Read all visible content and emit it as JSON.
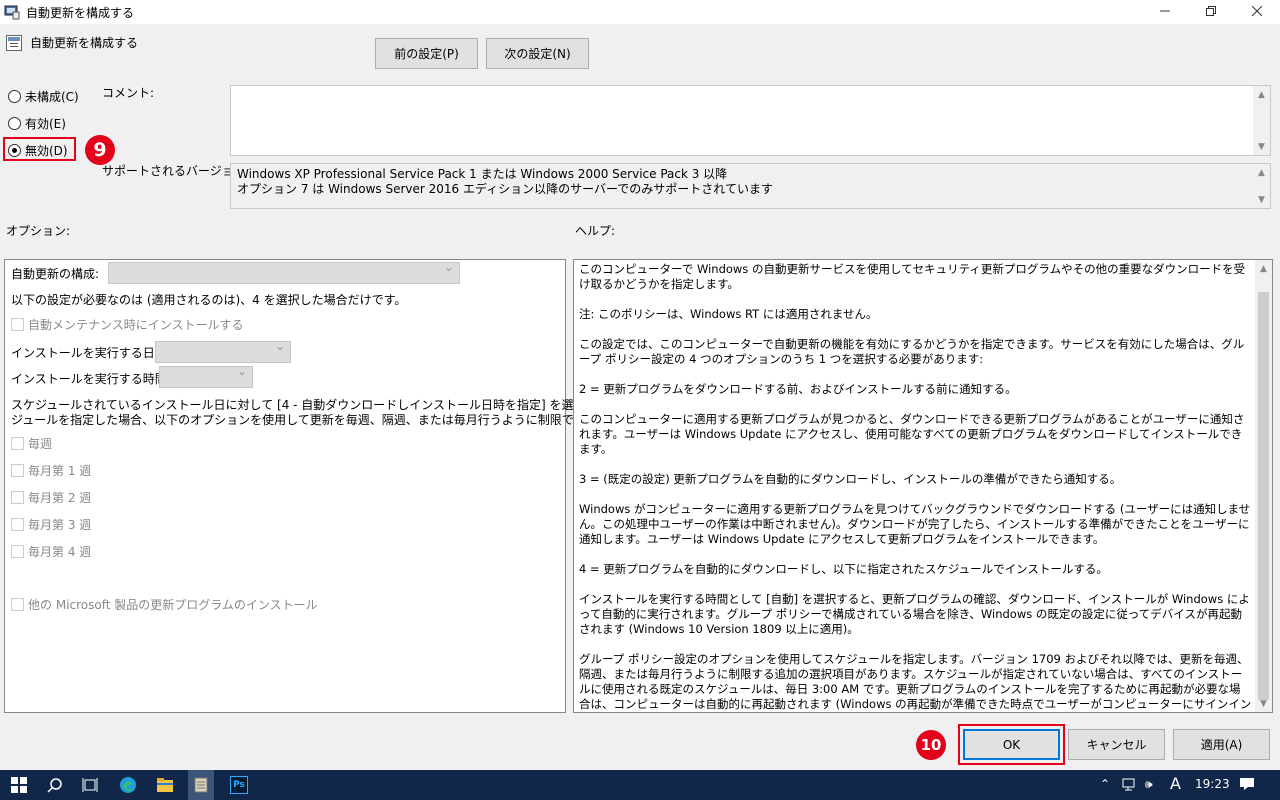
{
  "window": {
    "title": "自動更新を構成する",
    "minimize_icon": "minimize-icon",
    "maximize_icon": "restore-icon",
    "close_icon": "close-icon"
  },
  "header": {
    "policy_name": "自動更新を構成する",
    "prev_button": "前の設定(P)",
    "next_button": "次の設定(N)"
  },
  "state_options": {
    "not_configured": "未構成(C)",
    "enabled": "有効(E)",
    "disabled": "無効(D)",
    "selected": "disabled"
  },
  "comment_label": "コメント:",
  "supported_label": "サポートされるバージョン:",
  "supported_text": [
    "Windows XP Professional Service Pack 1 または Windows 2000 Service Pack 3 以降",
    "オプション 7 は Windows Server 2016 エディション以降のサーバーでのみサポートされています"
  ],
  "options_label": "オプション:",
  "help_label": "ヘルプ:",
  "options": {
    "configure_label": "自動更新の構成:",
    "note": "以下の設定が必要なのは (適用されるのは)、4 を選択した場合だけです。",
    "auto_maint": "自動メンテナンス時にインストールする",
    "install_day_label": "インストールを実行する日:",
    "install_time_label": "インストールを実行する時間:",
    "schedule_note_1": "スケジュールされているインストール日に対して [4 - 自動ダウンロードしインストール日時を指定] を選択してスケ",
    "schedule_note_2": "ジュールを指定した場合、以下のオプションを使用して更新を毎週、隔週、または毎月行うように制限できます。",
    "weekly": "毎週",
    "week1": "毎月第 1 週",
    "week2": "毎月第 2 週",
    "week3": "毎月第 3 週",
    "week4": "毎月第 4 週",
    "other_ms": "他の Microsoft 製品の更新プログラムのインストール"
  },
  "help_paragraphs": [
    "このコンピューターで Windows の自動更新サービスを使用してセキュリティ更新プログラムやその他の重要なダウンロードを受け取るかどうかを指定します。",
    "注: このポリシーは、Windows RT には適用されません。",
    "この設定では、このコンピューターで自動更新の機能を有効にするかどうかを指定できます。サービスを有効にした場合は、グループ ポリシー設定の 4 つのオプションのうち 1 つを選択する必要があります:",
    " 2 = 更新プログラムをダウンロードする前、およびインストールする前に通知する。",
    " このコンピューターに適用する更新プログラムが見つかると、ダウンロードできる更新プログラムがあることがユーザーに通知されます。ユーザーは Windows Update にアクセスし、使用可能なすべての更新プログラムをダウンロードしてインストールできます。",
    " 3 = (既定の設定) 更新プログラムを自動的にダウンロードし、インストールの準備ができたら通知する。",
    " Windows がコンピューターに適用する更新プログラムを見つけてバックグラウンドでダウンロードする (ユーザーには通知しません。この処理中ユーザーの作業は中断されません)。ダウンロードが完了したら、インストールする準備ができたことをユーザーに通知します。ユーザーは Windows Update にアクセスして更新プログラムをインストールできます。",
    " 4 = 更新プログラムを自動的にダウンロードし、以下に指定されたスケジュールでインストールする。",
    " インストールを実行する時間として [自動] を選択すると、更新プログラムの確認、ダウンロード、インストールが Windows によって自動的に実行されます。グループ ポリシーで構成されている場合を除き、Windows の既定の設定に従ってデバイスが再起動されます (Windows 10 Version 1809 以上に適用)。",
    " グループ ポリシー設定のオプションを使用してスケジュールを指定します。バージョン 1709 およびそれ以降では、更新を毎週、隔週、または毎月行うように制限する追加の選択項目があります。スケジュールが指定されていない場合は、すべてのインストールに使用される既定のスケジュールは、毎日 3:00 AM です。更新プログラムのインストールを完了するために再起動が必要な場合は、コンピューターは自動的に再起動されます (Windows の再起動が準備できた時点でユーザーがコンピューターにサインインしている場合は、ユーザーに通知が表示され、再起動を延期するオプションが表示されます)。"
  ],
  "footer": {
    "ok": "OK",
    "cancel": "キャンセル",
    "apply": "適用(A)"
  },
  "markers": {
    "step9": "9",
    "step10": "10"
  },
  "taskbar": {
    "clock": "19:23",
    "ime": "A",
    "icons": [
      "windows-start-icon",
      "search-icon",
      "task-view-icon",
      "edge-icon",
      "file-explorer-icon",
      "notepad-icon",
      "photoshop-icon"
    ],
    "ps_label": "Ps"
  },
  "colors": {
    "accent": "#0078d7",
    "marker_red": "#e3001b",
    "taskbar": "#10274a"
  }
}
